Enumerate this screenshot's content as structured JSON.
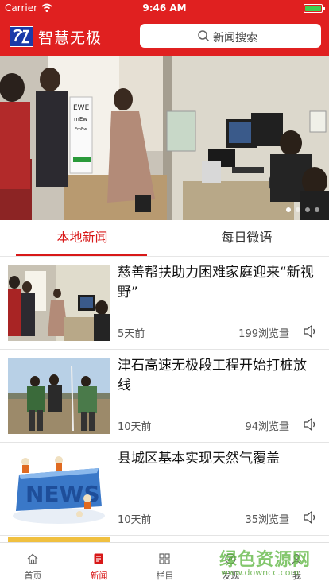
{
  "status_bar": {
    "carrier": "Carrier",
    "time": "9:46 AM",
    "battery_level": 1.0
  },
  "header": {
    "app_title": "智慧无极",
    "search_placeholder": "新闻搜索",
    "brand_color": "#e02020"
  },
  "banner": {
    "slide_count": 4,
    "active_slide": 1
  },
  "tabs": [
    {
      "label": "本地新闻",
      "active": true
    },
    {
      "label": "每日微语",
      "active": false
    }
  ],
  "news": [
    {
      "title": "慈善帮扶助力困难家庭迎来“新视野”",
      "time": "5天前",
      "views": "199浏览量",
      "thumb": "eye-test-photo"
    },
    {
      "title": "津石高速无极段工程开始打桩放线",
      "time": "10天前",
      "views": "94浏览量",
      "thumb": "construction-survey-photo"
    },
    {
      "title": "县城区基本实现天然气覆盖",
      "time": "10天前",
      "views": "35浏览量",
      "thumb": "news-graphic"
    }
  ],
  "bottom_nav": [
    {
      "label": "首页",
      "icon": "home-icon",
      "active": false
    },
    {
      "label": "新闻",
      "icon": "news-icon",
      "active": true
    },
    {
      "label": "栏目",
      "icon": "grid-icon",
      "active": false
    },
    {
      "label": "发现",
      "icon": "compass-icon",
      "active": false
    },
    {
      "label": "我",
      "icon": "user-icon",
      "active": false
    }
  ],
  "watermark": {
    "text": "绿色资源网",
    "url": "www.downcc.com"
  }
}
